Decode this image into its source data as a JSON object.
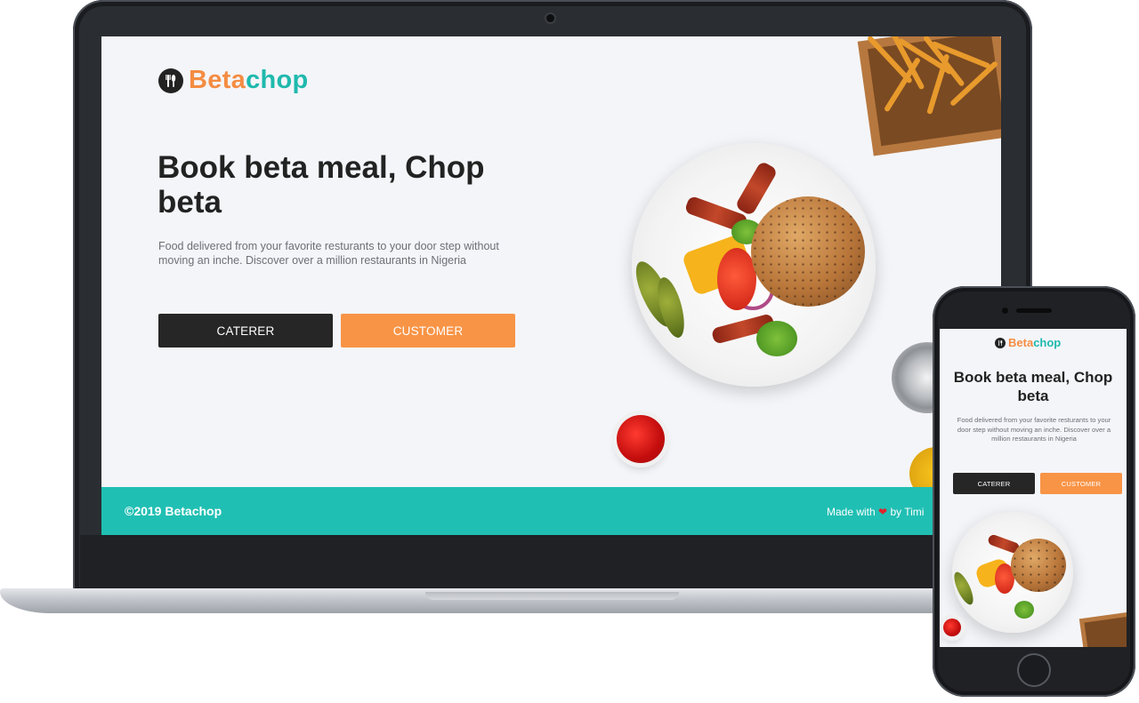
{
  "brand": {
    "part1": "Beta",
    "part2": "chop",
    "accent_orange": "#f48c42",
    "accent_teal": "#1fb9ad"
  },
  "hero": {
    "title": "Book beta meal, Chop beta",
    "description": "Food delivered from your favorite resturants to your door step without moving an inche. Discover over a million restaurants in Nigeria"
  },
  "buttons": {
    "caterer": "CATERER",
    "customer": "CUSTOMER"
  },
  "footer": {
    "copyright": "©2019 Betachop",
    "made_prefix": "Made with",
    "heart": "❤",
    "made_suffix": "by Timi",
    "background": "#20bfb3"
  },
  "mobile": {
    "title": "Book beta meal, Chop beta",
    "description": "Food delivered from your favorite resturants to your door step without moving an inche. Discover over a million restaurants in Nigeria",
    "caterer": "CATERER",
    "customer": "CUSTOMER"
  },
  "icons": {
    "logo": "fork-knife-icon"
  }
}
